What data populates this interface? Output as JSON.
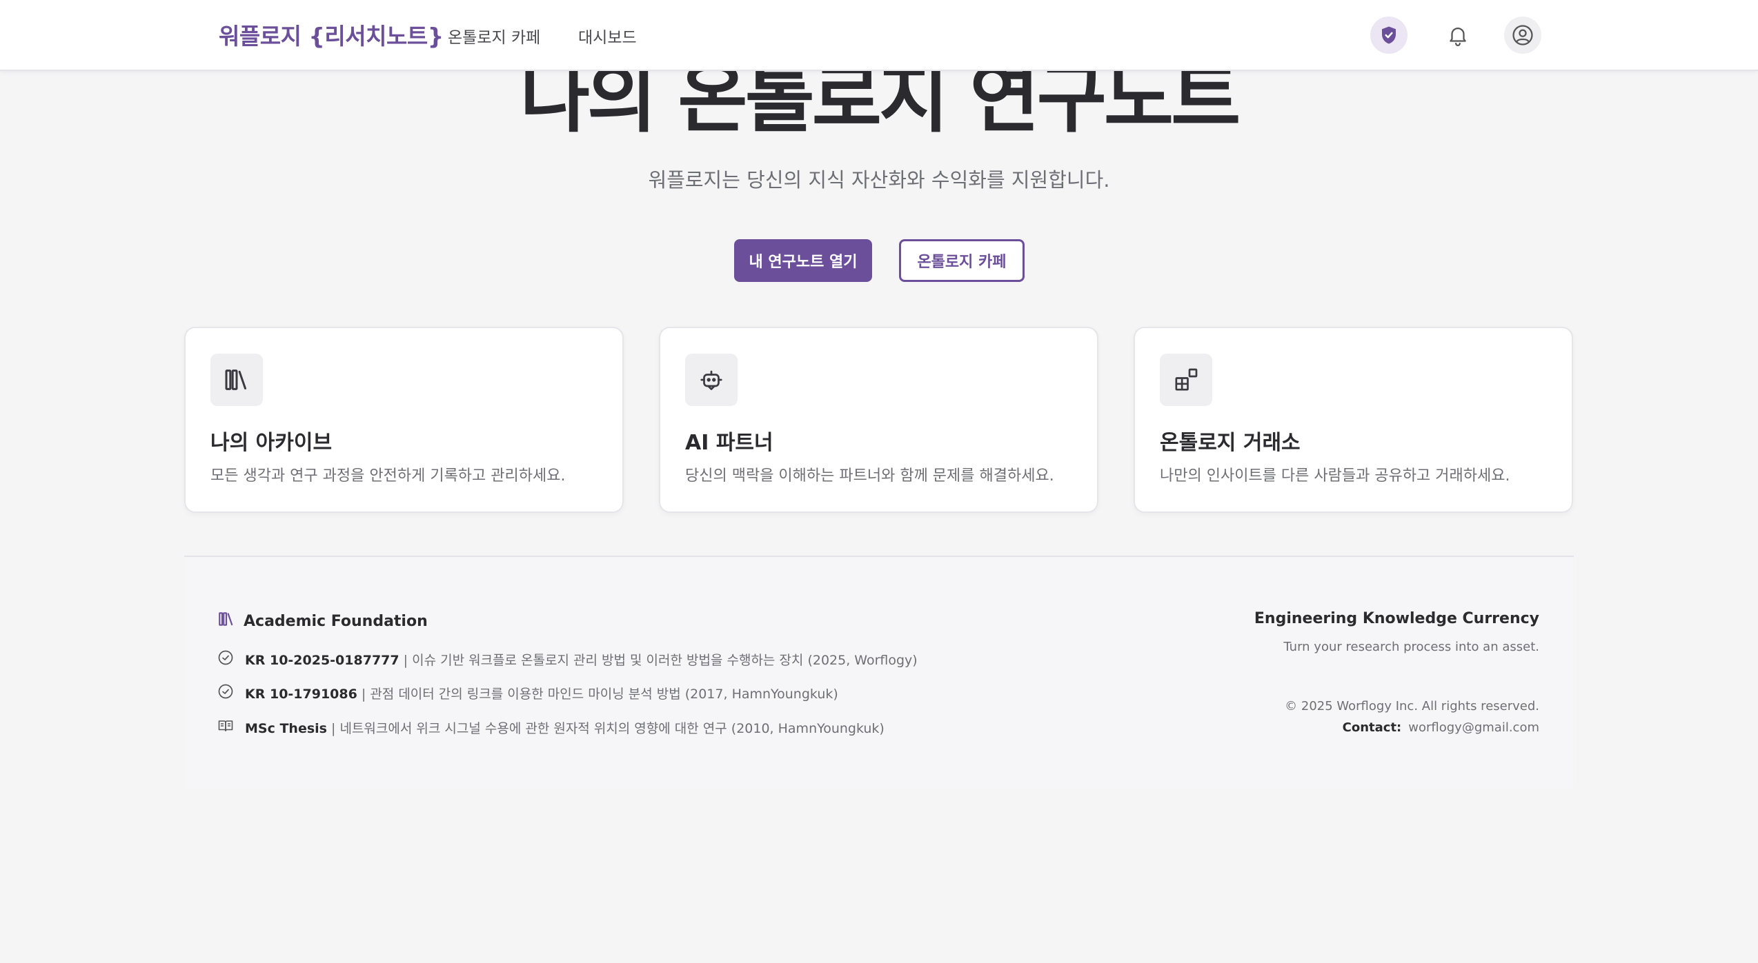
{
  "nav": {
    "brand": "워플로지 {리서치노트}",
    "links": [
      "온톨로지 카페",
      "대시보드"
    ],
    "icons": [
      "shield-check-icon",
      "bell-icon",
      "user-circle-icon"
    ],
    "accent": "#6b4f9a"
  },
  "hero": {
    "title": "나의 온톨로지 연구노트",
    "subtitle": "워플로지는 당신의 지식 자산화와 수익화를 지원합니다.",
    "primary_button": "내 연구노트 열기",
    "secondary_button": "온톨로지 카페"
  },
  "cards": [
    {
      "icon": "library-icon",
      "title": "나의 아카이브",
      "desc": "모든 생각과 연구 과정을 안전하게 기록하고 관리하세요."
    },
    {
      "icon": "bot-icon",
      "title": "AI 파트너",
      "desc": "당신의 맥락을 이해하는 파트너와 함께 문제를 해결하세요."
    },
    {
      "icon": "blocks-icon",
      "title": "온톨로지 거래소",
      "desc": "나만의 인사이트를 다른 사람들과 공유하고 거래하세요."
    }
  ],
  "footer": {
    "left_title": "Academic Foundation",
    "items": [
      {
        "icon": "check-circle-icon",
        "label": "KR 10-2025-0187777",
        "text": " | 이슈 기반 워크플로 온톨로지 관리 방법 및 이러한 방법을 수행하는 장치 (2025, Worflogy)"
      },
      {
        "icon": "check-circle-icon",
        "label": "KR 10-1791086",
        "text": " | 관점 데이터 간의 링크를 이용한 마인드 마이닝 분석 방법 (2017, HamnYoungkuk)"
      },
      {
        "icon": "book-open-icon",
        "label": "MSc Thesis",
        "text": " | 네트워크에서 위크 시그널 수용에 관한 원자적 위치의 영향에 대한 연구 (2010, HamnYoungkuk)"
      }
    ],
    "right_title": "Engineering Knowledge Currency",
    "right_sub": "Turn your research process into an asset.",
    "copyright": "© 2025 Worflogy Inc. All rights reserved.",
    "contact_label": "Contact:",
    "contact_email": "worflogy@gmail.com"
  }
}
